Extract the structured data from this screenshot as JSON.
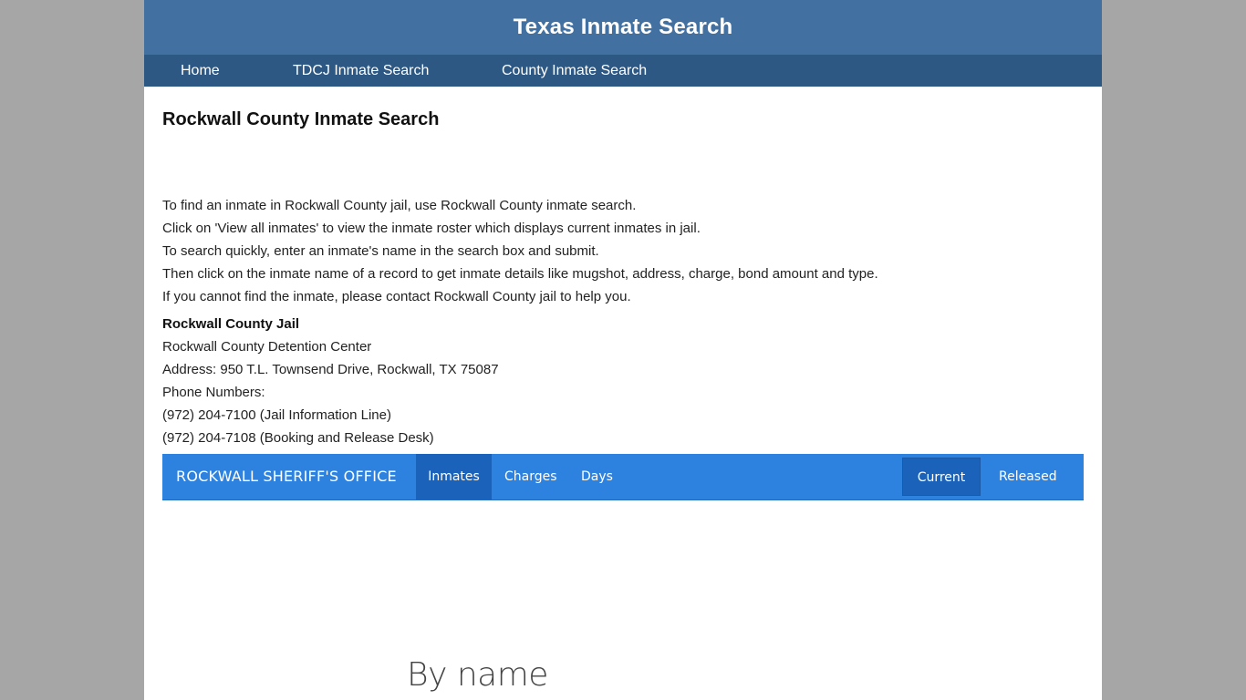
{
  "header": {
    "title": "Texas Inmate Search"
  },
  "nav": {
    "items": [
      {
        "label": "Home"
      },
      {
        "label": "TDCJ Inmate Search"
      },
      {
        "label": "County Inmate Search"
      }
    ]
  },
  "main": {
    "heading": "Rockwall County Inmate Search",
    "intro": [
      "To find an inmate in Rockwall County jail, use Rockwall County inmate search.",
      "Click on 'View all inmates' to view the inmate roster which displays current inmates in jail.",
      "To search quickly, enter an inmate's name in the search box and submit.",
      "Then click on the inmate name of a record to get inmate details like mugshot, address, charge, bond amount and type.",
      "If you cannot find the inmate, please contact Rockwall County jail to help you."
    ],
    "jail": {
      "name": "Rockwall County Jail",
      "facility": "Rockwall County Detention Center",
      "address": "Address: 950 T.L. Townsend Drive, Rockwall, TX 75087",
      "phone_label": "Phone Numbers:",
      "phones": [
        "(972) 204-7100 (Jail Information Line)",
        "(972) 204-7108 (Booking and Release Desk)"
      ]
    }
  },
  "sheriff_bar": {
    "brand": "ROCKWALL SHERIFF'S OFFICE",
    "tabs": [
      {
        "label": "Inmates",
        "active": true
      },
      {
        "label": "Charges",
        "active": false
      },
      {
        "label": "Days",
        "active": false
      }
    ],
    "right_tabs": [
      {
        "label": "Current",
        "active": true
      },
      {
        "label": "Released",
        "active": false
      }
    ],
    "colors": {
      "bar": "#2d82e0",
      "active": "#1b63ba"
    }
  },
  "search_section": {
    "heading": "By name"
  },
  "colors": {
    "header": "#4270a0",
    "nav": "#2d5884",
    "page_background": "#a6a6a6"
  }
}
